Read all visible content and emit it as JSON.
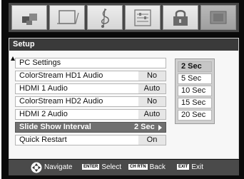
{
  "menu": {
    "title": "Setup",
    "items": [
      {
        "label": "PC Settings",
        "value": ""
      },
      {
        "label": "ColorStream HD1 Audio",
        "value": "No"
      },
      {
        "label": "HDMI 1 Audio",
        "value": "Auto"
      },
      {
        "label": "ColorStream HD2 Audio",
        "value": "No"
      },
      {
        "label": "HDMI 2 Audio",
        "value": "Auto"
      },
      {
        "label": "Slide Show Interval",
        "value": "2 Sec"
      },
      {
        "label": "Quick Restart",
        "value": "On"
      }
    ],
    "selected_index": 5
  },
  "dropdown": {
    "options": [
      "2 Sec",
      "5 Sec",
      "10 Sec",
      "15 Sec",
      "20 Sec"
    ],
    "selected": "2 Sec"
  },
  "icons": [
    "picture-icon",
    "display-icon",
    "audio-icon",
    "setup-icon",
    "lock-icon",
    "photo-icon"
  ],
  "footer": {
    "navigate": "Navigate",
    "enter_key": "ENTER",
    "select": "Select",
    "back_key": "CH RTN",
    "back": "Back",
    "exit_key": "EXIT",
    "exit": "Exit"
  }
}
